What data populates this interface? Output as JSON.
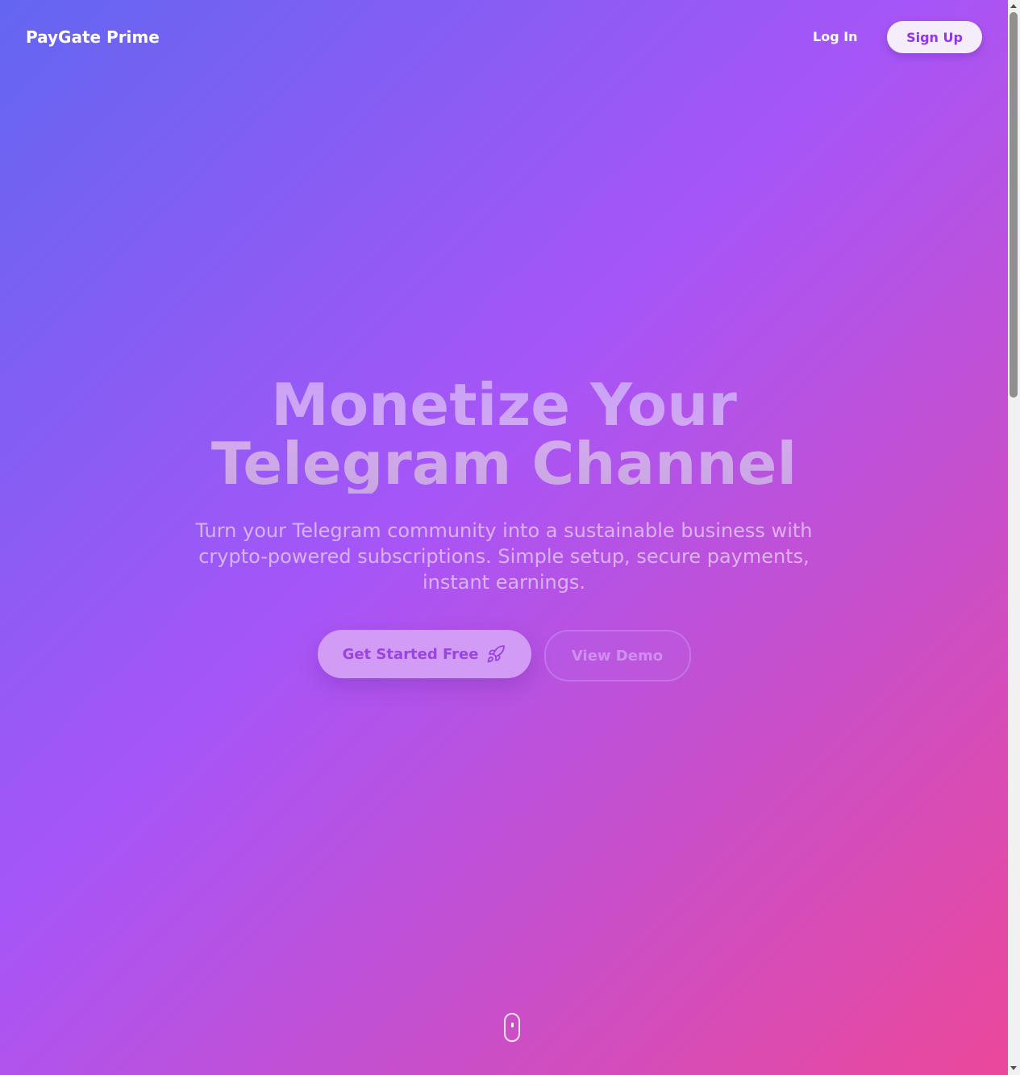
{
  "header": {
    "brand": "PayGate Prime",
    "login_label": "Log In",
    "signup_label": "Sign Up"
  },
  "hero": {
    "headline_line1": "Monetize Your",
    "headline_line2": "Telegram Channel",
    "subtitle": "Turn your Telegram community into a sustainable business with crypto-powered subscriptions. Simple setup, secure payments, instant earnings.",
    "primary_cta": "Get Started Free",
    "primary_cta_icon": "rocket-icon",
    "secondary_cta": "View Demo"
  },
  "scroll_indicator": {
    "icon": "mouse-scroll-icon"
  },
  "colors": {
    "gradient_start": "#6366f1",
    "gradient_mid": "#a855f7",
    "gradient_end": "#ec4899",
    "accent": "#9333ea"
  }
}
